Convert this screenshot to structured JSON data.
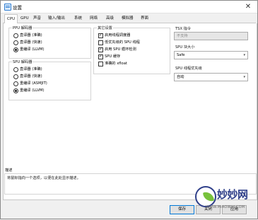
{
  "window": {
    "title": "设置",
    "close_glyph": "✕"
  },
  "tabs": [
    "CPU",
    "GPU",
    "声音",
    "输入/输出",
    "系统",
    "网络",
    "高级",
    "模拟器",
    "界面"
  ],
  "ppu": {
    "title": "PPU 解码器",
    "options": [
      "直译器 (准确)",
      "直译器 (快速)",
      "重编译 (LLVM)"
    ],
    "selected": 2
  },
  "spu": {
    "title": "SPU 解码器",
    "options": [
      "直译器 (准确)",
      "直译器 (快速)",
      "重编译 (ASMJIT)",
      "重编译 (LLVM)"
    ],
    "selected": 3
  },
  "other": {
    "title": "其它设置",
    "options": [
      {
        "label": "启用线程调度器",
        "checked": true
      },
      {
        "label": "低优先级的 SPU 线程",
        "checked": false
      },
      {
        "label": "启用 SPU 循环检测",
        "checked": true
      },
      {
        "label": "SPU 缓存",
        "checked": true
      },
      {
        "label": "准确的 xfloat",
        "checked": false
      }
    ]
  },
  "tsx": {
    "title": "TSX 指令",
    "value": "不支持"
  },
  "spu_block": {
    "title": "SPU 块大小",
    "value": "Safe"
  },
  "spu_priority": {
    "title": "SPU 线程优先级",
    "value": "自动"
  },
  "description": {
    "title": "描述",
    "text": "将鼠标指向一个选项，以便在此处显示描述。"
  },
  "buttons": {
    "save": "保存",
    "close": "关闭",
    "apply": "应用"
  },
  "watermark": {
    "brand": "妙妙网",
    "url": "WWW.MIAOWUI.COM"
  }
}
